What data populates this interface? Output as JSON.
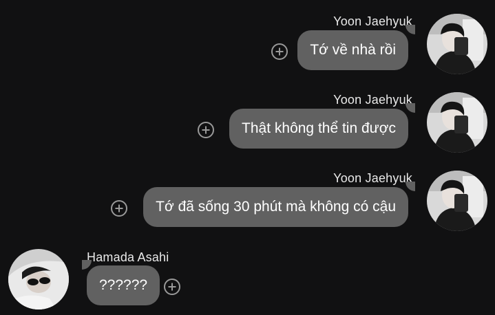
{
  "messages": [
    {
      "sender": "Yoon Jaehyuk",
      "text": "Tớ về nhà rồi",
      "side": "right",
      "avatar": "yoon-jaehyuk-avatar"
    },
    {
      "sender": "Yoon Jaehyuk",
      "text": "Thật không thể tin được",
      "side": "right",
      "avatar": "yoon-jaehyuk-avatar"
    },
    {
      "sender": "Yoon Jaehyuk",
      "text": "Tớ đã sống 30 phút mà không có cậu",
      "side": "right",
      "avatar": "yoon-jaehyuk-avatar"
    },
    {
      "sender": "Hamada Asahi",
      "text": "??????",
      "side": "left",
      "avatar": "hamada-asahi-avatar"
    }
  ],
  "icons": {
    "react": "add-reaction-icon"
  },
  "colors": {
    "background": "#111112",
    "bubble": "#616161",
    "text": "#ffffff",
    "name": "#e9e9e9"
  }
}
